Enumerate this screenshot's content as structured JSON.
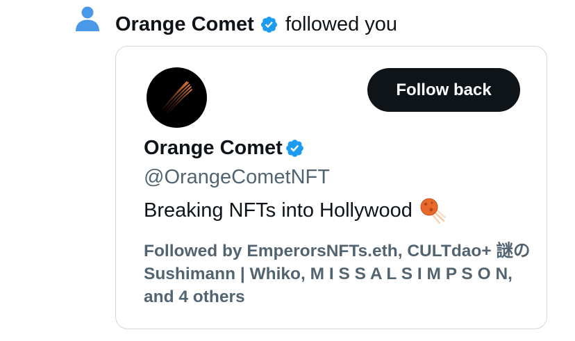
{
  "notification": {
    "icon": "person-icon",
    "user_name": "Orange Comet",
    "action_text": "followed you",
    "verified_badge": "verified-badge-icon"
  },
  "profile_card": {
    "avatar": "comet-logo-avatar",
    "follow_button_label": "Follow back",
    "display_name": "Orange Comet",
    "handle": "@OrangeCometNFT",
    "bio": "Breaking NFTs into Hollywood",
    "bio_emoji": "comet-emoji",
    "followed_by": "Followed by EmperorsNFTs.eth, CULTdao+ 謎のSushimann | Whiko, M I S S A L S I M P S O N, and 4 others"
  },
  "colors": {
    "accent_blue": "#1d9bf0",
    "text_primary": "#0f1419",
    "text_secondary": "#536471",
    "border": "#cfd9de",
    "button_bg": "#0f1419",
    "person_icon": "#4a99e9"
  }
}
